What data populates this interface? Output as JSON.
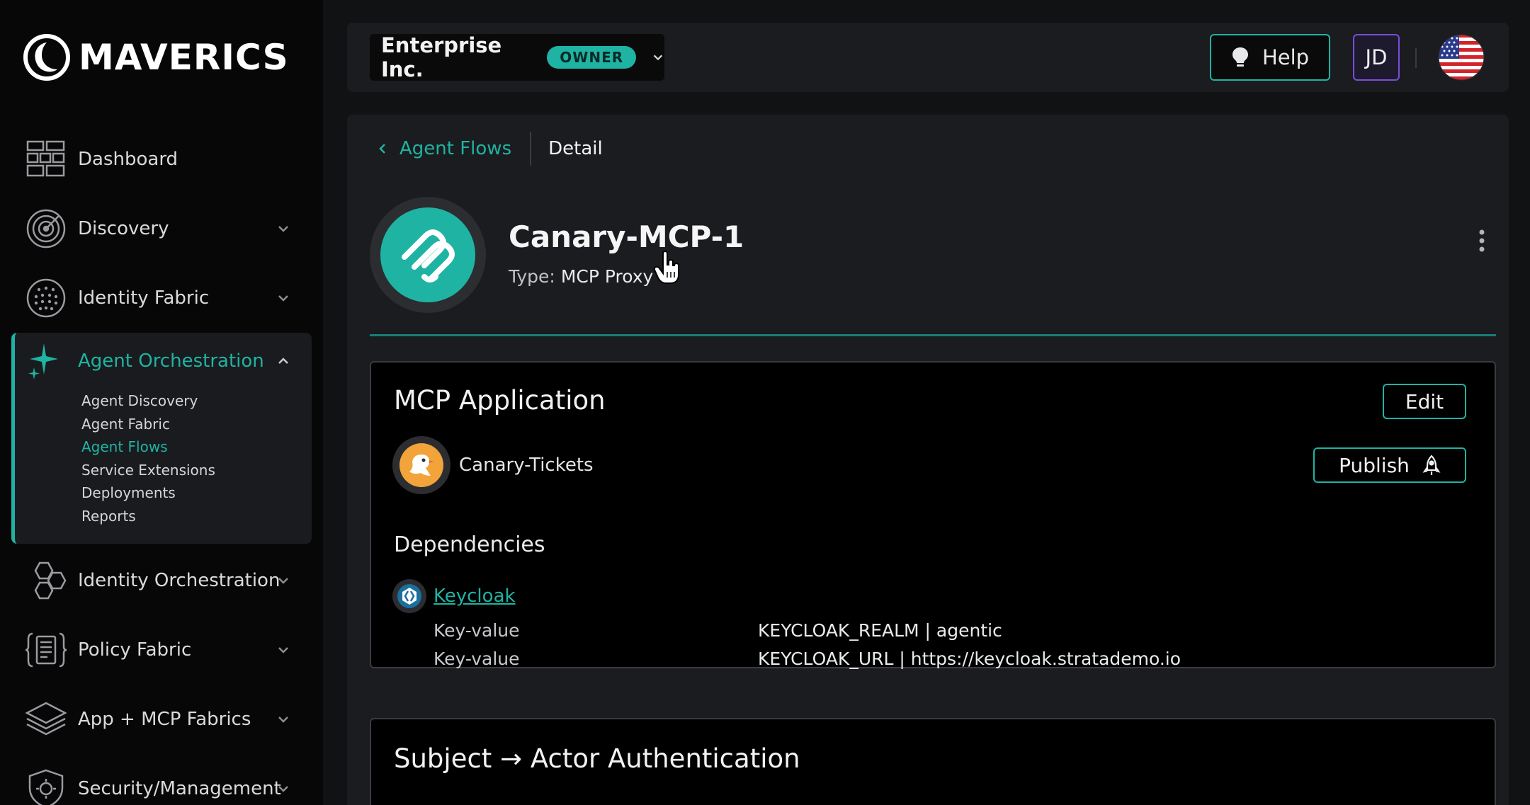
{
  "brand": {
    "name": "MAVERICS"
  },
  "sidebar": {
    "items": [
      {
        "label": "Dashboard",
        "icon": "dashboard-icon"
      },
      {
        "label": "Discovery",
        "icon": "radar-icon"
      },
      {
        "label": "Identity Fabric",
        "icon": "globe-dots-icon"
      },
      {
        "label": "Agent Orchestration",
        "icon": "sparkle-icon",
        "subitems": [
          "Agent Discovery",
          "Agent Fabric",
          "Agent Flows",
          "Service Extensions",
          "Deployments",
          "Reports"
        ],
        "active_subitem": "Agent Flows"
      },
      {
        "label": "Identity Orchestration",
        "icon": "hexagons-icon"
      },
      {
        "label": "Policy Fabric",
        "icon": "policy-document-icon"
      },
      {
        "label": "App + MCP Fabrics",
        "icon": "layers-icon"
      },
      {
        "label": "Security/Management",
        "icon": "shield-gear-icon"
      }
    ]
  },
  "topbar": {
    "org_name": "Enterprise Inc.",
    "role_badge": "OWNER",
    "help_label": "Help",
    "user_initials": "JD",
    "locale_flag": "us-flag-icon"
  },
  "breadcrumb": {
    "parent": "Agent Flows",
    "current": "Detail"
  },
  "flow": {
    "name": "Canary-MCP-1",
    "type_label": "Type:",
    "type_value": "MCP Proxy"
  },
  "mcp_application": {
    "title": "MCP Application",
    "edit_label": "Edit",
    "publish_label": "Publish",
    "app_name": "Canary-Tickets",
    "dependencies_title": "Dependencies",
    "dependency": {
      "name": "Keycloak",
      "entries": [
        {
          "label": "Key-value",
          "value": "KEYCLOAK_REALM | agentic"
        },
        {
          "label": "Key-value",
          "value": "KEYCLOAK_URL | https://keycloak.stratademo.io"
        }
      ]
    }
  },
  "auth_section": {
    "title": "Subject → Actor Authentication"
  },
  "colors": {
    "accent": "#1fb3a3",
    "background": "#111214",
    "panel": "#1b1c1f",
    "avatar_border": "#7a4cdc"
  }
}
